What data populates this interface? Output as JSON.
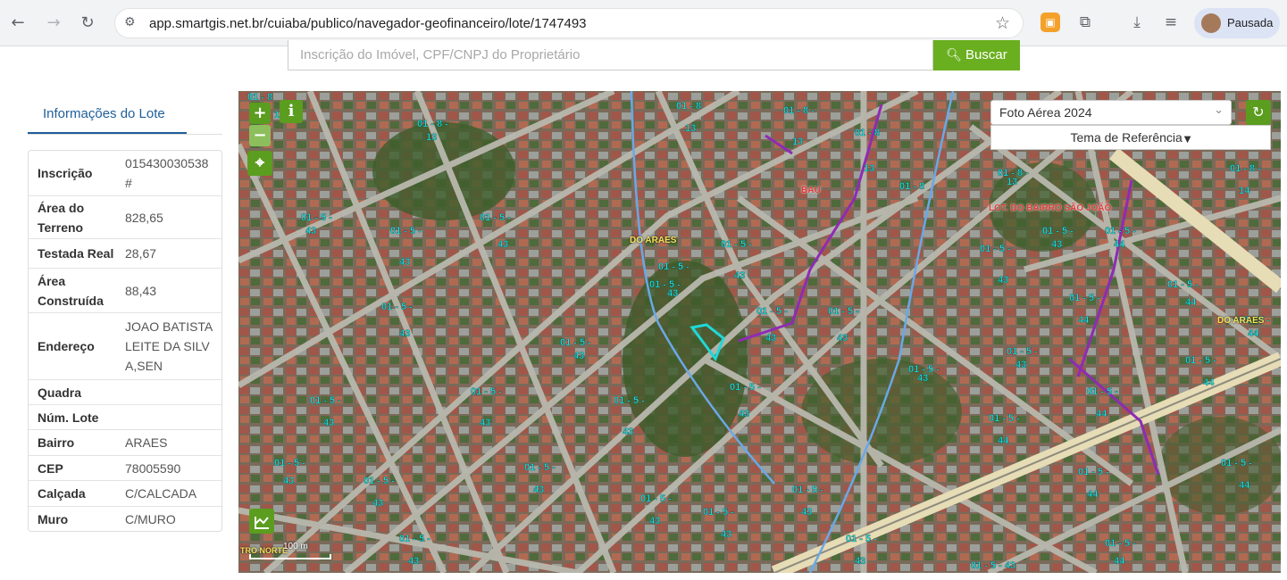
{
  "browser": {
    "url": "app.smartgis.net.br/cuiaba/publico/navegador-geofinanceiro/lote/1747493",
    "profile_label": "Pausada"
  },
  "search": {
    "placeholder": "Inscrição do Imóvel, CPF/CNPJ do Proprietário",
    "button_label": "Buscar"
  },
  "panel": {
    "tab_label": "Informações do Lote",
    "fields": [
      {
        "label": "Inscrição",
        "value": "015430030538#"
      },
      {
        "label": "Área do Terreno",
        "value": "828,65"
      },
      {
        "label": "Testada Real",
        "value": "28,67"
      },
      {
        "label": "Área Construída",
        "value": "88,43"
      },
      {
        "label": "Endereço",
        "value": "JOAO BATISTA LEITE DA SILVA,SEN"
      },
      {
        "label": "Quadra",
        "value": ""
      },
      {
        "label": "Núm. Lote",
        "value": ""
      },
      {
        "label": "Bairro",
        "value": "ARAES"
      },
      {
        "label": "CEP",
        "value": "78005590"
      },
      {
        "label": "Calçada",
        "value": "C/CALCADA"
      },
      {
        "label": "Muro",
        "value": "C/MURO"
      }
    ]
  },
  "map": {
    "layer_select": "Foto Aérea 2024",
    "reference_theme": "Tema de Referência",
    "scale_label": "100 m",
    "labels": {
      "do_araes": "DO ARAES",
      "bau": "BAU",
      "lot_bairro": "LOT. DO BAIRRO SÃO JOÃO",
      "do_araes_right": "DO ARAES",
      "north": "TRO NORTE"
    },
    "colors": {
      "accent": "#5a9d1f",
      "boundary": "#8e2bb5",
      "selected_lot": "#1fd8d8",
      "lot_label": "#1fe0e0"
    }
  }
}
